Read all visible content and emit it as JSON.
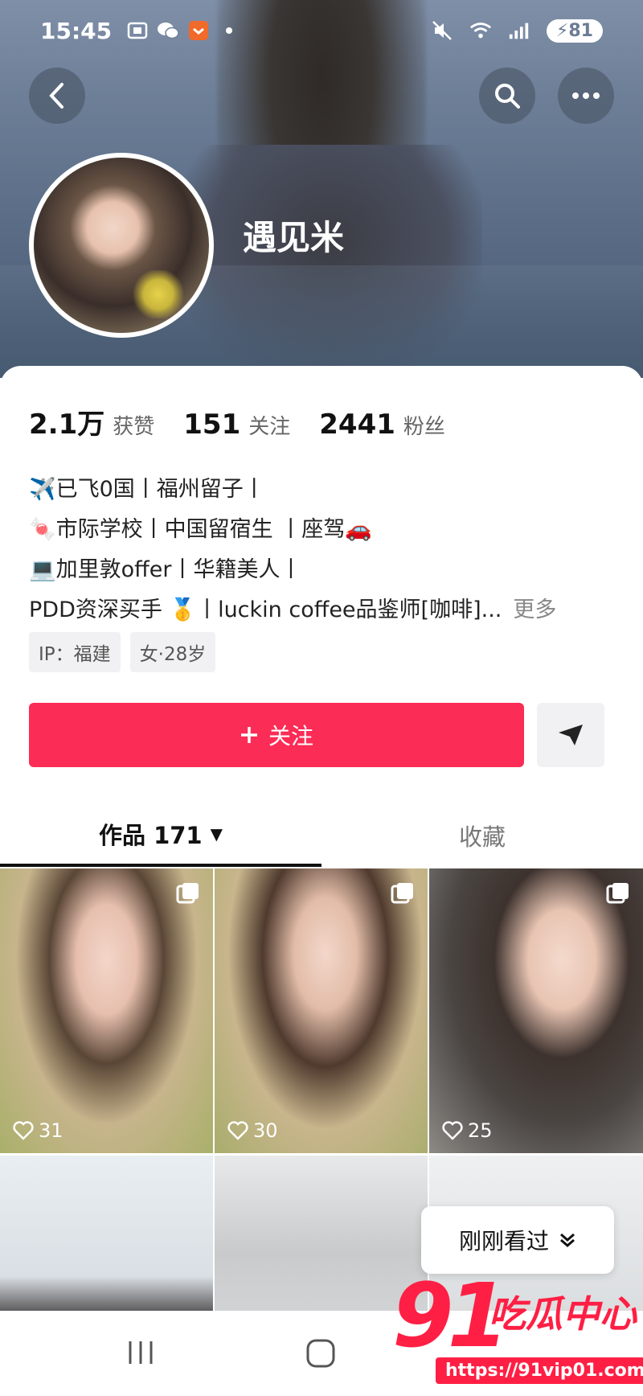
{
  "status_bar": {
    "time": "15:45",
    "battery": "81",
    "network": "4G"
  },
  "profile": {
    "name": "遇见米",
    "stats": [
      {
        "value": "2.1万",
        "label": "获赞"
      },
      {
        "value": "151",
        "label": "关注"
      },
      {
        "value": "2441",
        "label": "粉丝"
      }
    ],
    "bio": [
      "✈️已飞0国丨福州留子丨",
      "🍬市际学校丨中国留宿生 丨座驾🚗",
      "💻加里敦offer丨华籍美人丨",
      "PDD资深买手 🥇丨luckin coffee品鉴师[咖啡]..."
    ],
    "more_label": "更多",
    "tags": [
      "IP：福建",
      "女·28岁"
    ],
    "follow_label": "关注"
  },
  "tabs": {
    "works_label": "作品 171",
    "favorites_label": "收藏"
  },
  "grid": {
    "items": [
      {
        "likes": "31"
      },
      {
        "likes": "30"
      },
      {
        "likes": "25"
      },
      {
        "likes": ""
      },
      {
        "likes": ""
      },
      {
        "likes": ""
      }
    ]
  },
  "recent_pill": {
    "label": "刚刚看过"
  },
  "watermark": {
    "number": "91",
    "title": "吃瓜中心",
    "url": "https://91vip01.com"
  },
  "colors": {
    "accent": "#fb2c55",
    "watermark": "#ff1f44"
  }
}
